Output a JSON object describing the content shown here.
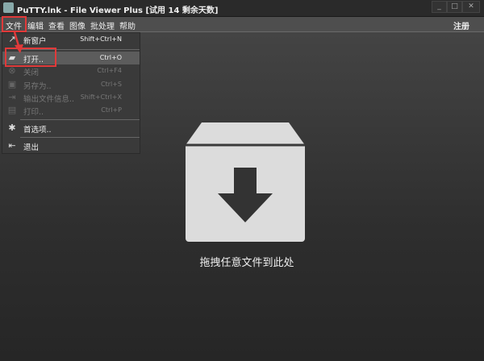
{
  "window": {
    "title": "PuTTY.lnk - File Viewer Plus [试用 14 剩余天数]",
    "minimize": "_",
    "maximize": "□",
    "close": "✕"
  },
  "menubar": {
    "items": [
      "文件",
      "编辑",
      "查看",
      "图像",
      "批处理",
      "帮助"
    ],
    "register": "注册"
  },
  "file_menu": {
    "items": [
      {
        "label": "新窗户",
        "shortcut": "Shift+Ctrl+N",
        "icon": "external-window-icon",
        "glyph": "↗"
      },
      {
        "label": "打开..",
        "shortcut": "Ctrl+O",
        "icon": "folder-open-icon",
        "glyph": "▰"
      },
      {
        "label": "关闭",
        "shortcut": "Ctrl+F4",
        "icon": "close-circle-icon",
        "glyph": "⊗"
      },
      {
        "label": "另存为..",
        "shortcut": "Ctrl+S",
        "icon": "save-icon",
        "glyph": "▣"
      },
      {
        "label": "输出文件信息..",
        "shortcut": "Shift+Ctrl+X",
        "icon": "export-icon",
        "glyph": "⇥"
      },
      {
        "label": "打印..",
        "shortcut": "Ctrl+P",
        "icon": "print-icon",
        "glyph": "▤"
      },
      {
        "label": "首选项..",
        "shortcut": "",
        "icon": "gear-icon",
        "glyph": "✱"
      },
      {
        "label": "退出",
        "shortcut": "",
        "icon": "exit-icon",
        "glyph": "⇤"
      }
    ]
  },
  "main": {
    "drop_text": "拖拽任意文件到此处",
    "accent": "#e03a3a"
  }
}
